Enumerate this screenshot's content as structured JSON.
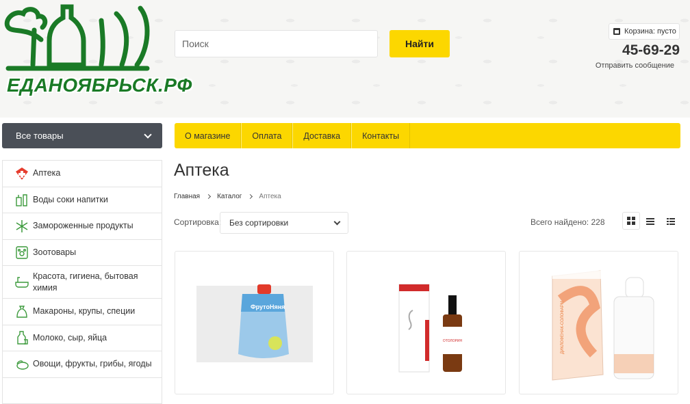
{
  "logo": {
    "text": "ЕДАНОЯБРЬСК.РФ",
    "color": "#1a7a26"
  },
  "search": {
    "placeholder": "Поиск",
    "button": "Найти"
  },
  "cart": {
    "label": "Корзина: пусто",
    "icon": "cart-icon"
  },
  "contacts": {
    "phone": "45-69-29",
    "send_message": "Отправить сообщение"
  },
  "all_goods": "Все товары",
  "categories": [
    {
      "label": "Аптека",
      "icon": "pharmacy-icon"
    },
    {
      "label": "Воды соки напитки",
      "icon": "drinks-icon"
    },
    {
      "label": "Замороженные продукты",
      "icon": "snowflake-icon"
    },
    {
      "label": "Зоотовары",
      "icon": "paw-icon"
    },
    {
      "label": "Красота, гигиена, бытовая химия",
      "icon": "bathtub-icon"
    },
    {
      "label": "Макароны, крупы, специи",
      "icon": "sack-icon"
    },
    {
      "label": "Молоко, сыр, яйца",
      "icon": "milk-icon"
    },
    {
      "label": "Овощи, фрукты, грибы, ягоды",
      "icon": "vegetables-icon"
    }
  ],
  "menu": [
    "О магазине",
    "Оплата",
    "Доставка",
    "Контакты"
  ],
  "page_title": "Аптека",
  "breadcrumbs": [
    "Главная",
    "Каталог",
    "Аптека"
  ],
  "sort": {
    "label": "Сортировка:",
    "value": "Без сортировки"
  },
  "found": {
    "label": "Всего найдено:",
    "count": "228"
  },
  "products": [
    {
      "label": "ФрутоНяня",
      "image": "baby-puree-pouch"
    },
    {
      "label": "ОТОЛОРИН",
      "image": "ear-drops-box-and-bottle"
    },
    {
      "label": "ДИКЛОФЕНАК-СОЛОФАРМ",
      "image": "eye-drops-box-and-bottle"
    }
  ],
  "colors": {
    "accent": "#fcd700",
    "dark": "#4a4f57",
    "brand_green": "#1a7a26"
  }
}
